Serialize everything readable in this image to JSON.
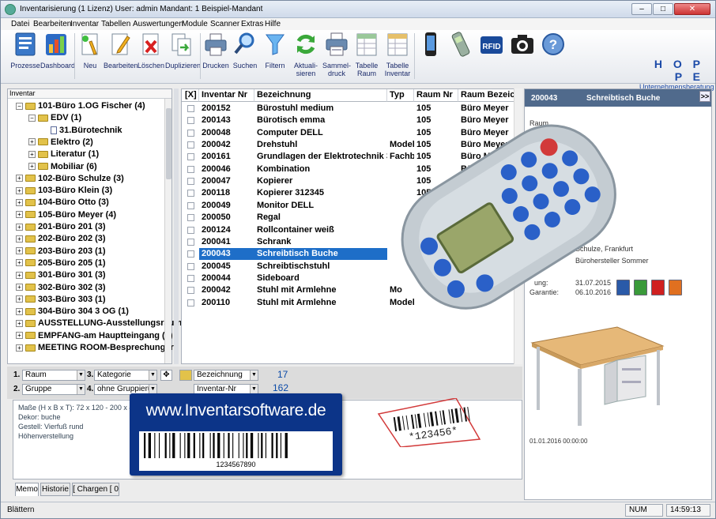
{
  "window": {
    "title": "Inventarisierung  (1 Lizenz)    User: admin    Mandant: 1 Beispiel-Mandant",
    "controls": [
      "–",
      "□",
      "✕"
    ]
  },
  "menu": [
    "Datei",
    "Bearbeiten",
    "Inventar",
    "Tabellen",
    "Auswertungen",
    "Module",
    "Scanner",
    "Extras",
    "Hilfe"
  ],
  "toolbar": [
    {
      "label": "Prozesse",
      "icon": "clipboard-icon"
    },
    {
      "label": "Dashboard",
      "icon": "bar-chart-icon"
    },
    {
      "label": "Neu",
      "icon": "new-document-icon"
    },
    {
      "label": "Bearbeiten",
      "icon": "edit-pencil-icon"
    },
    {
      "label": "Löschen",
      "icon": "delete-icon"
    },
    {
      "label": "Duplizieren",
      "icon": "duplicate-icon"
    },
    {
      "label": "Drucken",
      "icon": "printer-icon"
    },
    {
      "label": "Suchen",
      "icon": "search-icon"
    },
    {
      "label": "Filtern",
      "icon": "filter-icon"
    },
    {
      "label": "Aktuali-\nsieren",
      "icon": "refresh-icon"
    },
    {
      "label": "Sammel-\ndruck",
      "icon": "batch-print-icon"
    },
    {
      "label": "Tabelle\nRaum",
      "icon": "room-table-icon"
    },
    {
      "label": "Tabelle\nInventar",
      "icon": "inventory-table-icon"
    },
    {
      "label": "",
      "icon": "mobile-phone-icon"
    },
    {
      "label": "",
      "icon": "handheld-scanner-icon"
    },
    {
      "label": "",
      "icon": "rfid-icon"
    },
    {
      "label": "",
      "icon": "camera-icon"
    },
    {
      "label": "",
      "icon": "help-icon"
    }
  ],
  "brand": {
    "name": "H O P P E",
    "sub": "Unternehmensberatung",
    "color": "#1b4aa8"
  },
  "tree": {
    "header": "Inventar",
    "items": [
      {
        "label": "101-Büro 1.OG  Fischer  (4)",
        "level": 0,
        "type": "folder",
        "expand": "−"
      },
      {
        "label": "EDV  (1)",
        "level": 1,
        "type": "folder",
        "expand": "−"
      },
      {
        "label": "31.Bürotechnik",
        "level": 2,
        "type": "page",
        "expand": ""
      },
      {
        "label": "Elektro  (2)",
        "level": 1,
        "type": "folder",
        "expand": "+"
      },
      {
        "label": "Literatur  (1)",
        "level": 1,
        "type": "folder",
        "expand": "+"
      },
      {
        "label": "Mobiliar  (6)",
        "level": 1,
        "type": "folder",
        "expand": "+"
      },
      {
        "label": "102-Büro  Schulze  (3)",
        "level": 0,
        "type": "folder",
        "expand": "+"
      },
      {
        "label": "103-Büro Klein  (3)",
        "level": 0,
        "type": "folder",
        "expand": "+"
      },
      {
        "label": "104-Büro  Otto  (3)",
        "level": 0,
        "type": "folder",
        "expand": "+"
      },
      {
        "label": "105-Büro  Meyer  (4)",
        "level": 0,
        "type": "folder",
        "expand": "+"
      },
      {
        "label": "201-Büro 201  (3)",
        "level": 0,
        "type": "folder",
        "expand": "+"
      },
      {
        "label": "202-Büro 202  (3)",
        "level": 0,
        "type": "folder",
        "expand": "+"
      },
      {
        "label": "203-Büro 203  (1)",
        "level": 0,
        "type": "folder",
        "expand": "+"
      },
      {
        "label": "205-Büro 205  (1)",
        "level": 0,
        "type": "folder",
        "expand": "+"
      },
      {
        "label": "301-Büro 301  (3)",
        "level": 0,
        "type": "folder",
        "expand": "+"
      },
      {
        "label": "302-Büro 302  (3)",
        "level": 0,
        "type": "folder",
        "expand": "+"
      },
      {
        "label": "303-Büro 303  (1)",
        "level": 0,
        "type": "folder",
        "expand": "+"
      },
      {
        "label": "304-Büro 304  3 OG  (1)",
        "level": 0,
        "type": "folder",
        "expand": "+"
      },
      {
        "label": "AUSSTELLUNG-Ausstellungsraum",
        "level": 0,
        "type": "folder",
        "expand": "+"
      },
      {
        "label": "EMPFANG-am Hauptteingang  (2)",
        "level": 0,
        "type": "folder",
        "expand": "+"
      },
      {
        "label": "MEETING ROOM-Besprechungsr",
        "level": 0,
        "type": "folder",
        "expand": "+"
      }
    ]
  },
  "grid": {
    "columns": [
      "[X]",
      "Inventar Nr",
      "Bezeichnung",
      "Typ",
      "Raum Nr",
      "Raum Bezeichn"
    ],
    "rows": [
      {
        "nr": "200152",
        "bez": "Bürostuhl medium",
        "typ": "",
        "raum": "105",
        "rbez": "Büro  Meyer"
      },
      {
        "nr": "200143",
        "bez": "Bürotisch emma",
        "typ": "",
        "raum": "105",
        "rbez": "Büro  Meyer"
      },
      {
        "nr": "200048",
        "bez": "Computer DELL",
        "typ": "",
        "raum": "105",
        "rbez": "Büro  Meyer"
      },
      {
        "nr": "200042",
        "bez": "Drehstuhl",
        "typ": "Modell",
        "raum": "105",
        "rbez": "Büro  Meyer"
      },
      {
        "nr": "200161",
        "bez": "Grundlagen der Elektrotechnik 3",
        "typ": "Fachbu",
        "raum": "105",
        "rbez": "Büro  Meyer"
      },
      {
        "nr": "200046",
        "bez": "Kombination",
        "typ": "",
        "raum": "105",
        "rbez": "Büro  Meyer"
      },
      {
        "nr": "200047",
        "bez": "Kopierer",
        "typ": "",
        "raum": "105",
        "rbez": ""
      },
      {
        "nr": "200118",
        "bez": "Kopierer 312345",
        "typ": "",
        "raum": "105",
        "rbez": ""
      },
      {
        "nr": "200049",
        "bez": "Monitor DELL",
        "typ": "",
        "raum": "105",
        "rbez": ""
      },
      {
        "nr": "200050",
        "bez": "Regal",
        "typ": "",
        "raum": "105",
        "rbez": ""
      },
      {
        "nr": "200124",
        "bez": "Rollcontainer weiß",
        "typ": "",
        "raum": "",
        "rbez": ""
      },
      {
        "nr": "200041",
        "bez": "Schrank",
        "typ": "",
        "raum": "",
        "rbez": ""
      },
      {
        "nr": "200043",
        "bez": "Schreibtisch Buche",
        "typ": "",
        "raum": "",
        "rbez": "",
        "selected": true
      },
      {
        "nr": "200045",
        "bez": "Schreibtischstuhl",
        "typ": "",
        "raum": "",
        "rbez": ""
      },
      {
        "nr": "200044",
        "bez": "Sideboard",
        "typ": "",
        "raum": "",
        "rbez": ""
      },
      {
        "nr": "200042",
        "bez": "Stuhl mit Armlehne",
        "typ": "Mo",
        "raum": "",
        "rbez": ""
      },
      {
        "nr": "200110",
        "bez": "Stuhl mit Armlehne",
        "typ": "Model",
        "raum": "",
        "rbez": ""
      }
    ]
  },
  "detail": {
    "header_nr": "200043",
    "header_title": "Schreibtisch Buche",
    "expand": ">>",
    "frag_raum": "Raum",
    "supplier1": "Schulze, Frankfurt",
    "supplier2": "Bürohersteller Sommer",
    "label_date1": "ung:",
    "date1": "31.07.2015",
    "label_date2": "Garantie:",
    "date2": "06.10.2016",
    "photo_date": "01.01.2016 00:00:00"
  },
  "filters": {
    "row1": {
      "n1": "1.",
      "sel1": "Raum",
      "n2": "3.",
      "sel2": "Kategorie",
      "sort_field": "Bezeichnung",
      "count": "17"
    },
    "row2": {
      "n1": "2.",
      "sel1": "Gruppe",
      "n2": "4.",
      "sel2": "ohne Gruppierung",
      "sort_field": "Inventar-Nr",
      "count": "162"
    }
  },
  "memo": {
    "lines": [
      "Maße (H x B x T): 72 x 120 - 200 x 80",
      "Dekor: buche",
      "Gestell: Vierfuß rund",
      "Höhenverstellung"
    ]
  },
  "tabs": [
    "Memo",
    "Historie",
    "[ Chargen [  0"
  ],
  "status": {
    "left": "Blättern",
    "num": "NUM",
    "time": "14:59:13"
  },
  "banner": {
    "text": "www.Inventarsoftware.de",
    "barcode": "1234567890"
  },
  "label_barcode": "*123456*"
}
